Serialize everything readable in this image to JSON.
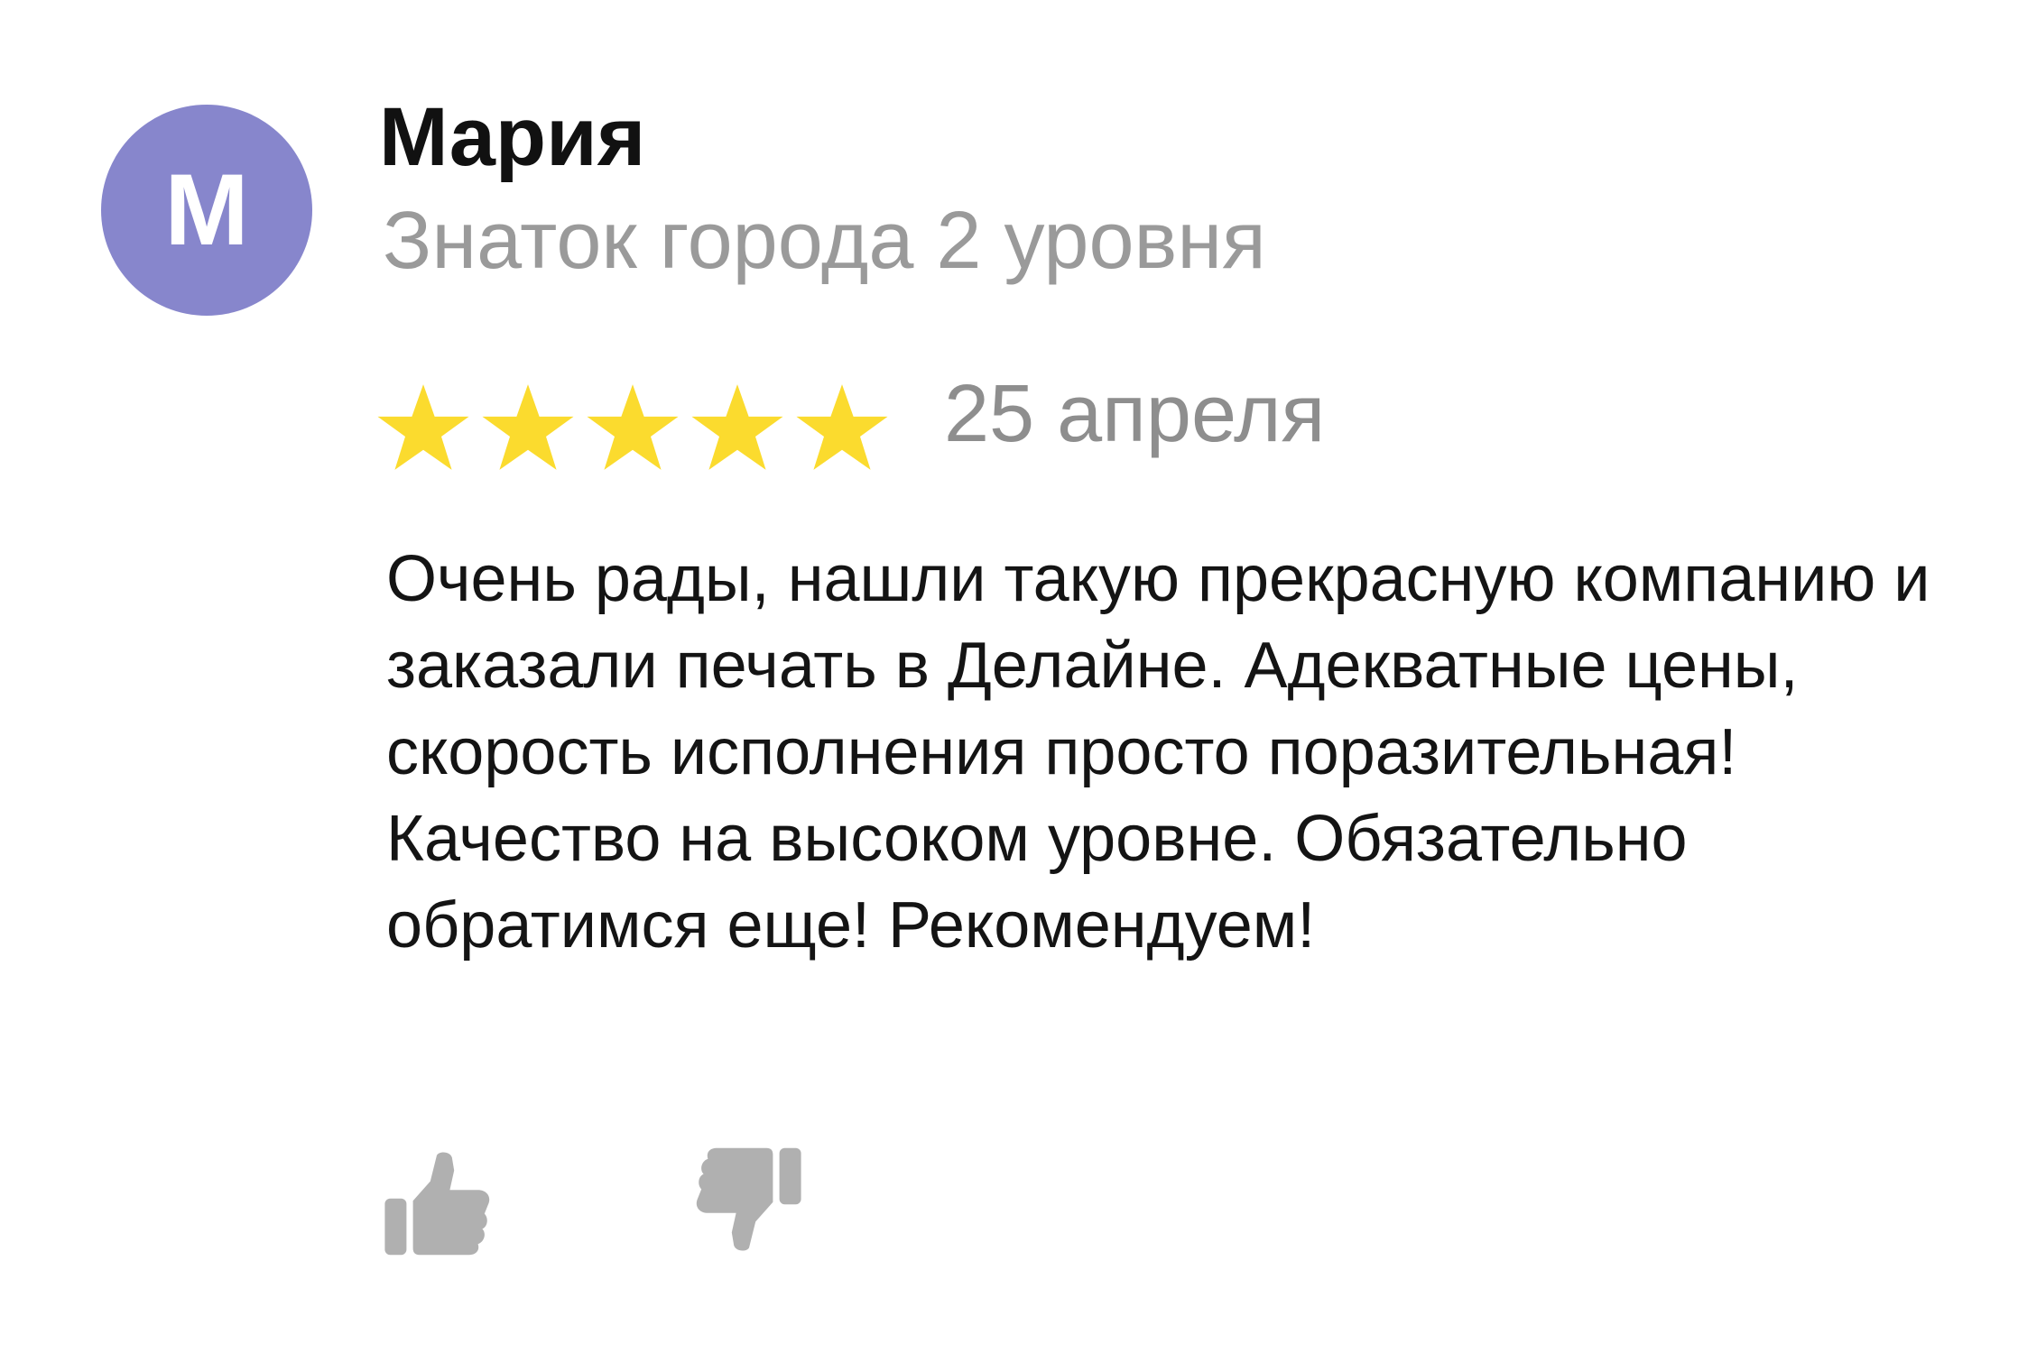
{
  "review": {
    "author": {
      "initial": "М",
      "name": "Мария",
      "level": "Знаток города 2 уровня",
      "avatar_color": "#8786cc"
    },
    "rating": {
      "value": 5,
      "max": 5,
      "star_color": "#fbdb2e"
    },
    "date": "25 апреля",
    "text": "Очень рады, нашли такую прекрасную компанию и заказали печать в Делайне. Адекватные цены, скорость исполнения просто поразительная! Качество на высоком уровне. Обязательно обратимся еще! Рекомендуем!",
    "actions": {
      "like_icon": "thumbs-up-icon",
      "dislike_icon": "thumbs-down-icon",
      "icon_color": "#b0b0b0"
    }
  }
}
